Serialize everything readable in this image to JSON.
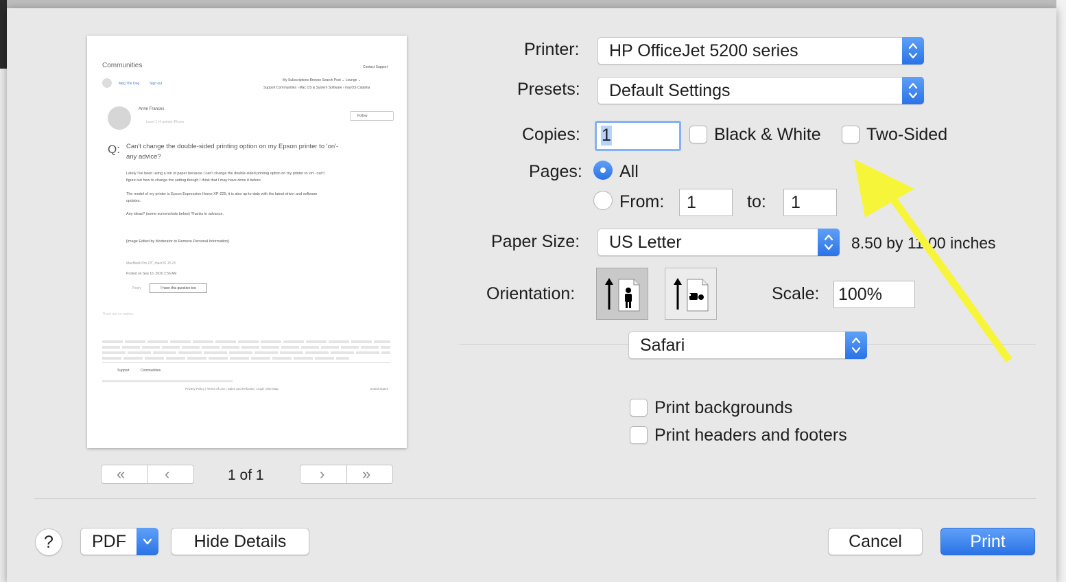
{
  "preview": {
    "header": "Communities",
    "contact": "Contact Support",
    "user": "Meg The Dog",
    "signout": "Sign out",
    "nav": "My Subscriptions    Browse    Search    Post ⌄    Lounge ⌄",
    "breadcrumb": "Support Communities  ›  Mac OS & System Software  ›  macOS Catalina",
    "author": "Anne Frances",
    "level": "Level 1  (4 points)          iPhone",
    "follow": "Follow",
    "q_mark": "Q:",
    "question_line1": "Can't change the double-sided printing option on my Epson printer to 'on'-",
    "question_line2": "any advice?",
    "body1_line1": "Lately I've been using a ton of paper because I can't change the double-sided printing option on my printer to 'on'- can't",
    "body1_line2": "figure out how to change the setting though I think that I may have done it before.",
    "body2_line1": "The model of my printer is Epson Expression Home XP-225; it is also up-to-date with the latest driver and software",
    "body2_line2": "updates.",
    "body3": "Any ideas? (some screenshots below) Thanks in advance.",
    "image_note": "[Image Edited by Moderator to Remove Personal Information]",
    "device": "MacBook Pro 13\", macOS 10.15",
    "posted": "Posted on Sep 16, 2020 2:56 AM",
    "reply": "Reply",
    "question_too": "I have this question too",
    "no_replies": "There are no replies.",
    "footer_support": "Support",
    "footer_communities": "Communities",
    "footer_links": "Privacy Policy  |  Terms of Use  |  Sales and Refunds  |  Legal  |  Site Map",
    "footer_country": "United States"
  },
  "pager": {
    "page_text": "1 of 1",
    "first": "«",
    "prev": "‹",
    "next": "›",
    "last": "»"
  },
  "printer": {
    "label": "Printer:",
    "value": "HP OfficeJet 5200 series"
  },
  "presets": {
    "label": "Presets:",
    "value": "Default Settings"
  },
  "copies": {
    "label": "Copies:",
    "value": "1"
  },
  "bw": {
    "label": "Black & White",
    "checked": false
  },
  "two_sided": {
    "label": "Two-Sided",
    "checked": false
  },
  "pages": {
    "label": "Pages:",
    "all": "All",
    "from_label": "From:",
    "from": "1",
    "to_label": "to:",
    "to": "1",
    "selected": "All"
  },
  "paper_size": {
    "label": "Paper Size:",
    "value": "US Letter",
    "dims": "8.50 by 11.00 inches"
  },
  "orientation": {
    "label": "Orientation:",
    "selected": "portrait"
  },
  "scale": {
    "label": "Scale:",
    "value": "100%"
  },
  "section": {
    "value": "Safari"
  },
  "options": {
    "backgrounds": "Print backgrounds",
    "headers": "Print headers and footers"
  },
  "bottom": {
    "help": "?",
    "pdf": "PDF",
    "hide": "Hide Details",
    "cancel": "Cancel",
    "print": "Print"
  },
  "colors": {
    "accent": "#2f76e8",
    "arrow": "#f7f53a",
    "sheet": "#e8e8e8"
  }
}
